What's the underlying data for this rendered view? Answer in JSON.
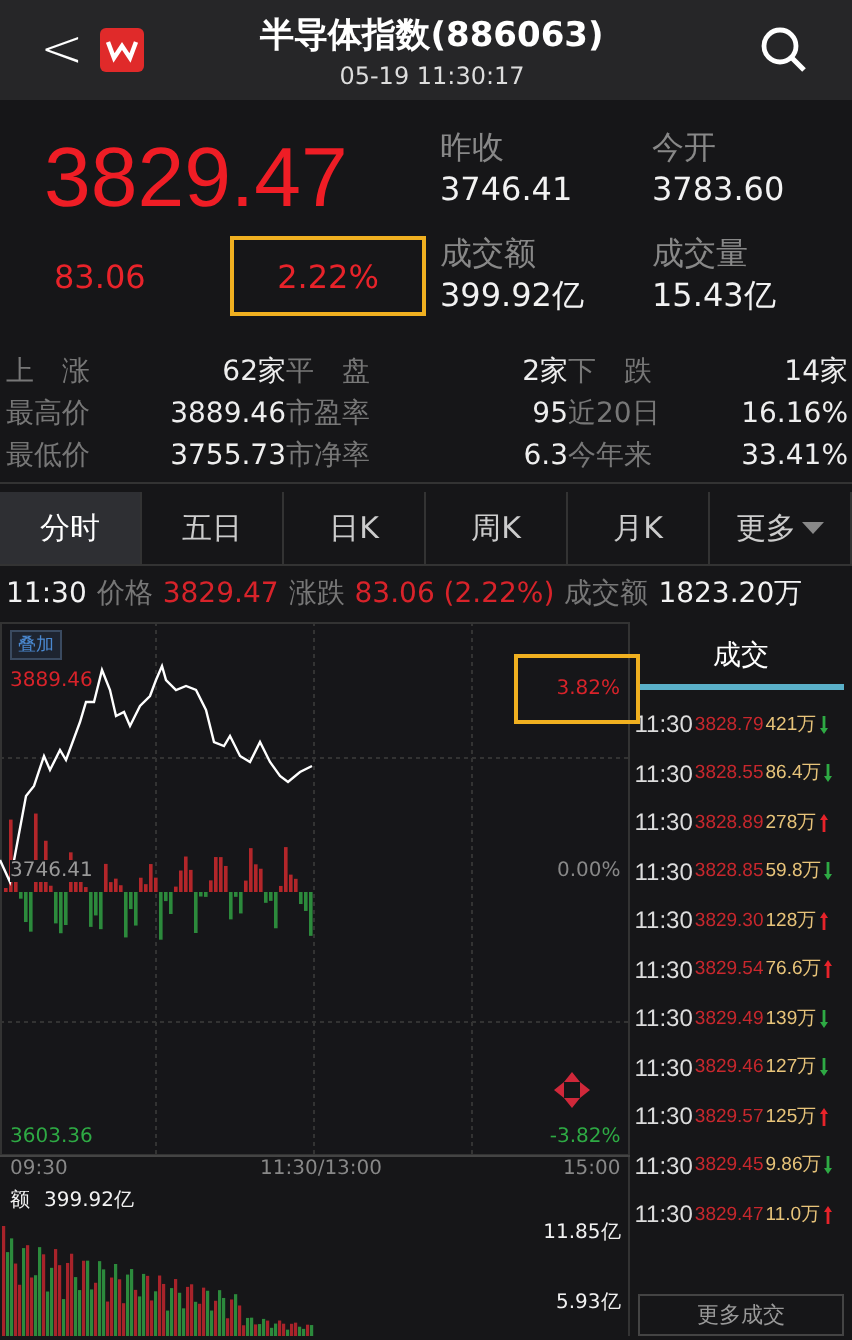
{
  "header": {
    "back": "<",
    "title": "半导体指数(886063)",
    "datetime": "05-19 11:30:17"
  },
  "quote": {
    "price": "3829.47",
    "change": "83.06",
    "change_pct": "2.22%",
    "pct_highlighted": true
  },
  "stats": [
    {
      "label": "昨收",
      "value": "3746.41"
    },
    {
      "label": "今开",
      "value": "3783.60"
    },
    {
      "label": "成交额",
      "value": "399.92亿"
    },
    {
      "label": "成交量",
      "value": "15.43亿"
    }
  ],
  "breadth": [
    {
      "label": "上　涨",
      "value": "62家"
    },
    {
      "label": "平　盘",
      "value": "2家"
    },
    {
      "label": "下　跌",
      "value": "14家"
    },
    {
      "label": "最高价",
      "value": "3889.46"
    },
    {
      "label": "市盈率",
      "value": "95"
    },
    {
      "label": "近20日",
      "value": "16.16%"
    },
    {
      "label": "最低价",
      "value": "3755.73"
    },
    {
      "label": "市净率",
      "value": "6.3"
    },
    {
      "label": "今年来",
      "value": "33.41%"
    }
  ],
  "tabs": [
    {
      "label": "分时",
      "selected": true,
      "kind": "tab"
    },
    {
      "label": "五日",
      "selected": false,
      "kind": "tab"
    },
    {
      "label": "日K",
      "selected": false,
      "kind": "tab"
    },
    {
      "label": "周K",
      "selected": false,
      "kind": "tab"
    },
    {
      "label": "月K",
      "selected": false,
      "kind": "tab"
    },
    {
      "label": "更多",
      "selected": false,
      "kind": "dropdown"
    }
  ],
  "info": {
    "time": "11:30",
    "price_label": "价格",
    "price": "3829.47",
    "change_label": "涨跌",
    "change": "83.06 (2.22%)",
    "amount_label": "成交额",
    "amount": "1823.20万"
  },
  "chart": {
    "overlay_button": "叠加",
    "high": "3889.46",
    "high_pct": "3.82%",
    "high_pct_highlighted": true,
    "base": "3746.41",
    "base_pct": "0.00%",
    "low": "3603.36",
    "low_pct": "-3.82%",
    "time_start": "09:30",
    "time_mid": "11:30/13:00",
    "time_end": "15:00",
    "volume_label": "额",
    "volume_total": "399.92亿",
    "volume_max": "11.85亿",
    "volume_mid": "5.93亿"
  },
  "trades": {
    "title": "成交",
    "more_button": "更多成交",
    "rows": [
      {
        "time": "11:30",
        "price": "3828.79",
        "volume": "421万",
        "uptick": false
      },
      {
        "time": "11:30",
        "price": "3828.55",
        "volume": "86.4万",
        "uptick": false
      },
      {
        "time": "11:30",
        "price": "3828.89",
        "volume": "278万",
        "uptick": true
      },
      {
        "time": "11:30",
        "price": "3828.85",
        "volume": "59.8万",
        "uptick": false
      },
      {
        "time": "11:30",
        "price": "3829.30",
        "volume": "128万",
        "uptick": true
      },
      {
        "time": "11:30",
        "price": "3829.54",
        "volume": "76.6万",
        "uptick": true
      },
      {
        "time": "11:30",
        "price": "3829.49",
        "volume": "139万",
        "uptick": false
      },
      {
        "time": "11:30",
        "price": "3829.46",
        "volume": "127万",
        "uptick": false
      },
      {
        "time": "11:30",
        "price": "3829.57",
        "volume": "125万",
        "uptick": true
      },
      {
        "time": "11:30",
        "price": "3829.45",
        "volume": "9.86万",
        "uptick": false
      },
      {
        "time": "11:30",
        "price": "3829.47",
        "volume": "11.0万",
        "uptick": true
      }
    ]
  }
}
